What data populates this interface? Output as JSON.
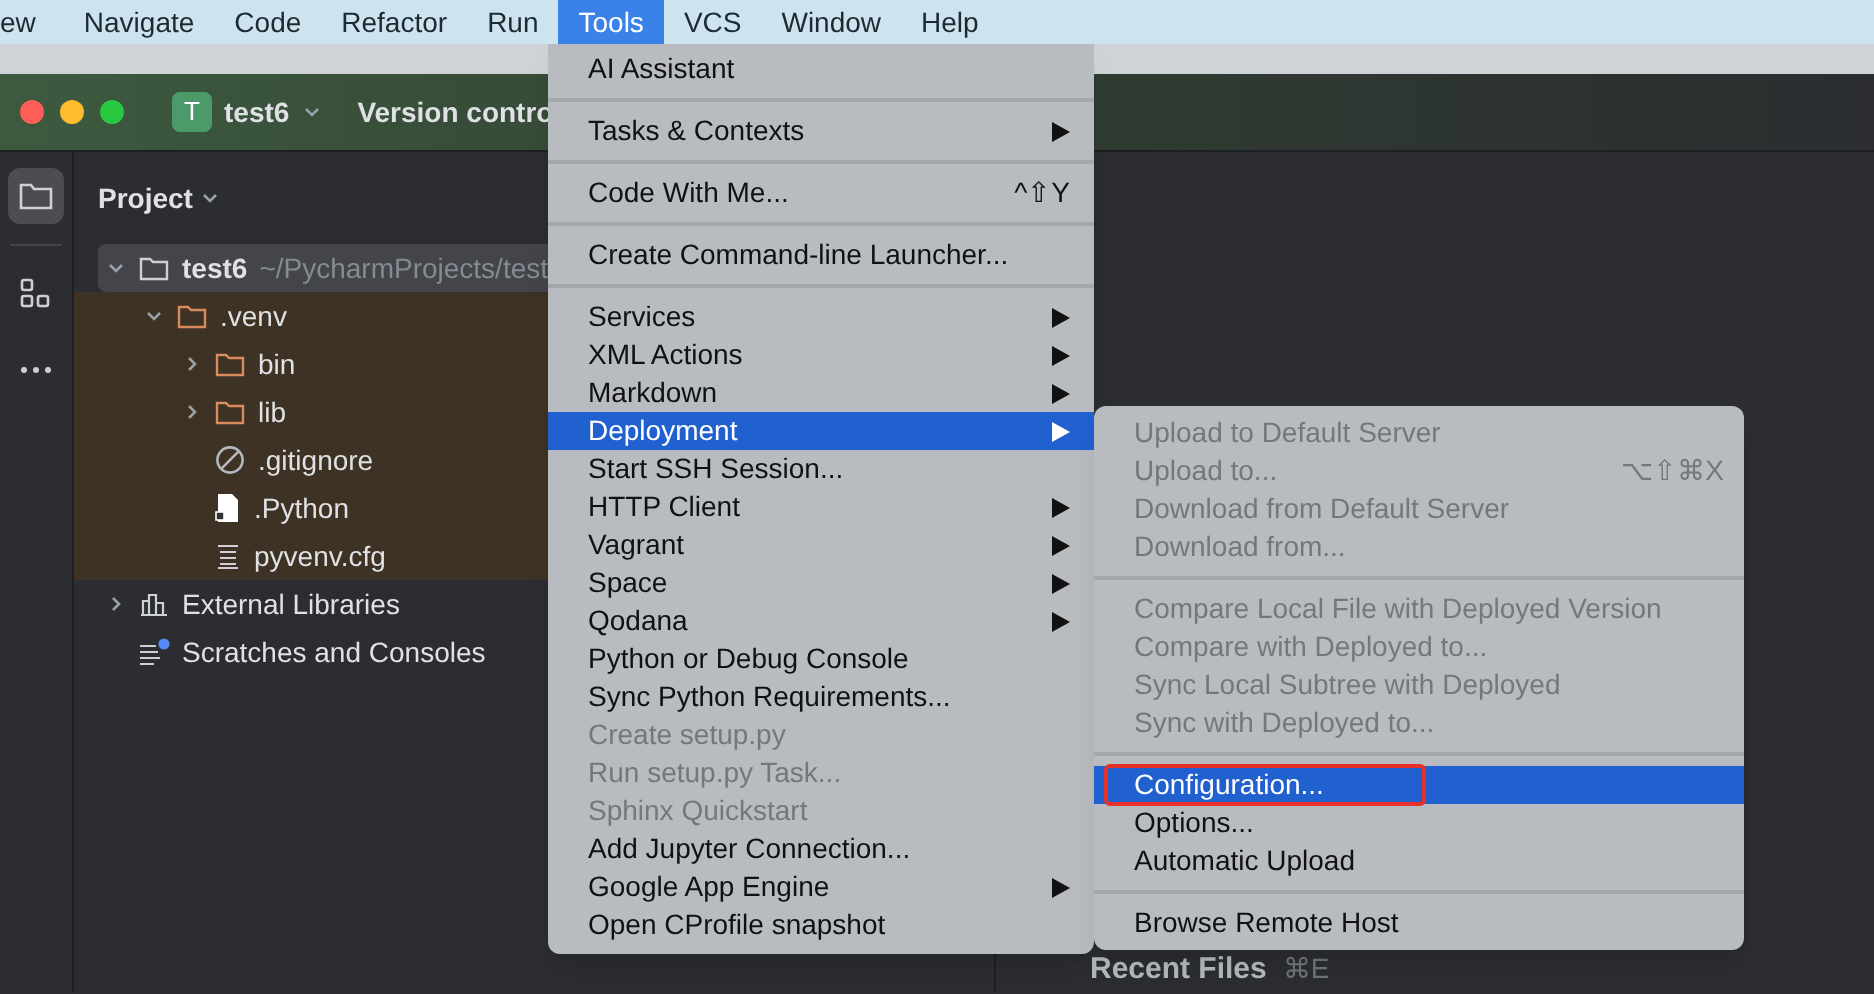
{
  "menu_bar": [
    {
      "label": "ew",
      "selected": false
    },
    {
      "label": "Navigate",
      "selected": false
    },
    {
      "label": "Code",
      "selected": false
    },
    {
      "label": "Refactor",
      "selected": false
    },
    {
      "label": "Run",
      "selected": false
    },
    {
      "label": "Tools",
      "selected": true
    },
    {
      "label": "VCS",
      "selected": false
    },
    {
      "label": "Window",
      "selected": false
    },
    {
      "label": "Help",
      "selected": false
    }
  ],
  "title_bar": {
    "project_badge": "T",
    "project": "test6",
    "vcs": "Version contro"
  },
  "tool_strip": [
    {
      "kind": "folder",
      "selected": true
    },
    {
      "kind": "structure",
      "selected": false
    },
    {
      "kind": "more",
      "selected": false
    }
  ],
  "project_panel": {
    "title": "Project",
    "tree": [
      {
        "label": "test6",
        "path": "~/PycharmProjects/test",
        "kind": "folder",
        "expanded": true,
        "selected": true,
        "children": [
          {
            "label": ".venv",
            "kind": "excluded-folder",
            "expanded": true,
            "excluded": true,
            "children": [
              {
                "label": "bin",
                "kind": "excluded-folder",
                "expanded": false,
                "excluded": true
              },
              {
                "label": "lib",
                "kind": "excluded-folder",
                "expanded": false,
                "excluded": true
              },
              {
                "label": ".gitignore",
                "kind": "ignore",
                "excluded": true
              },
              {
                "label": ".Python",
                "kind": "file",
                "excluded": true
              },
              {
                "label": "pyvenv.cfg",
                "kind": "text",
                "excluded": true
              }
            ]
          }
        ]
      },
      {
        "label": "External Libraries",
        "kind": "library",
        "expanded": false
      },
      {
        "label": "Scratches and Consoles",
        "kind": "scratch"
      }
    ]
  },
  "editor": {
    "hint": "Recent Files",
    "hint_shortcut": "⌘E"
  },
  "tools_menu": {
    "items": [
      {
        "kind": "item",
        "label": "AI Assistant",
        "submenu": false,
        "disabled": false,
        "selected": false
      },
      {
        "kind": "separator"
      },
      {
        "kind": "item",
        "label": "Tasks & Contexts",
        "submenu": true,
        "disabled": false,
        "selected": false
      },
      {
        "kind": "separator"
      },
      {
        "kind": "item",
        "label": "Code With Me...",
        "shortcut": "^⇧Y",
        "submenu": false,
        "disabled": false,
        "selected": false
      },
      {
        "kind": "separator"
      },
      {
        "kind": "item",
        "label": "Create Command-line Launcher...",
        "submenu": false,
        "disabled": false,
        "selected": false
      },
      {
        "kind": "separator"
      },
      {
        "kind": "item",
        "label": "Services",
        "submenu": true,
        "disabled": false,
        "selected": false
      },
      {
        "kind": "item",
        "label": "XML Actions",
        "submenu": true,
        "disabled": false,
        "selected": false
      },
      {
        "kind": "item",
        "label": "Markdown",
        "submenu": true,
        "disabled": false,
        "selected": false
      },
      {
        "kind": "item",
        "label": "Deployment",
        "submenu": true,
        "disabled": false,
        "selected": true
      },
      {
        "kind": "item",
        "label": "Start SSH Session...",
        "submenu": false,
        "disabled": false,
        "selected": false
      },
      {
        "kind": "item",
        "label": "HTTP Client",
        "submenu": true,
        "disabled": false,
        "selected": false
      },
      {
        "kind": "item",
        "label": "Vagrant",
        "submenu": true,
        "disabled": false,
        "selected": false
      },
      {
        "kind": "item",
        "label": "Space",
        "submenu": true,
        "disabled": false,
        "selected": false
      },
      {
        "kind": "item",
        "label": "Qodana",
        "submenu": true,
        "disabled": false,
        "selected": false
      },
      {
        "kind": "item",
        "label": "Python or Debug Console",
        "submenu": false,
        "disabled": false,
        "selected": false
      },
      {
        "kind": "item",
        "label": "Sync Python Requirements...",
        "submenu": false,
        "disabled": false,
        "selected": false
      },
      {
        "kind": "item",
        "label": "Create setup.py",
        "submenu": false,
        "disabled": true,
        "selected": false
      },
      {
        "kind": "item",
        "label": "Run setup.py Task...",
        "submenu": false,
        "disabled": true,
        "selected": false
      },
      {
        "kind": "item",
        "label": "Sphinx Quickstart",
        "submenu": false,
        "disabled": true,
        "selected": false
      },
      {
        "kind": "item",
        "label": "Add Jupyter Connection...",
        "submenu": false,
        "disabled": false,
        "selected": false
      },
      {
        "kind": "item",
        "label": "Google App Engine",
        "submenu": true,
        "disabled": false,
        "selected": false
      },
      {
        "kind": "item",
        "label": "Open CProfile snapshot",
        "submenu": false,
        "disabled": false,
        "selected": false
      }
    ]
  },
  "deployment_submenu": {
    "items": [
      {
        "kind": "item",
        "label": "Upload to Default Server",
        "disabled": true,
        "selected": false
      },
      {
        "kind": "item",
        "label": "Upload to...",
        "shortcut": "⌥⇧⌘X",
        "disabled": true,
        "selected": false
      },
      {
        "kind": "item",
        "label": "Download from Default Server",
        "disabled": true,
        "selected": false
      },
      {
        "kind": "item",
        "label": "Download from...",
        "disabled": true,
        "selected": false
      },
      {
        "kind": "separator"
      },
      {
        "kind": "item",
        "label": "Compare Local File with Deployed Version",
        "disabled": true,
        "selected": false
      },
      {
        "kind": "item",
        "label": "Compare with Deployed to...",
        "disabled": true,
        "selected": false
      },
      {
        "kind": "item",
        "label": "Sync Local Subtree with Deployed",
        "disabled": true,
        "selected": false
      },
      {
        "kind": "item",
        "label": "Sync with Deployed to...",
        "disabled": true,
        "selected": false
      },
      {
        "kind": "separator"
      },
      {
        "kind": "item",
        "label": "Configuration...",
        "disabled": false,
        "selected": true,
        "annotated": true
      },
      {
        "kind": "item",
        "label": "Options...",
        "disabled": false,
        "selected": false
      },
      {
        "kind": "item",
        "label": "Automatic Upload",
        "disabled": false,
        "selected": false
      },
      {
        "kind": "separator"
      },
      {
        "kind": "item",
        "label": "Browse Remote Host",
        "disabled": false,
        "selected": false
      }
    ]
  }
}
